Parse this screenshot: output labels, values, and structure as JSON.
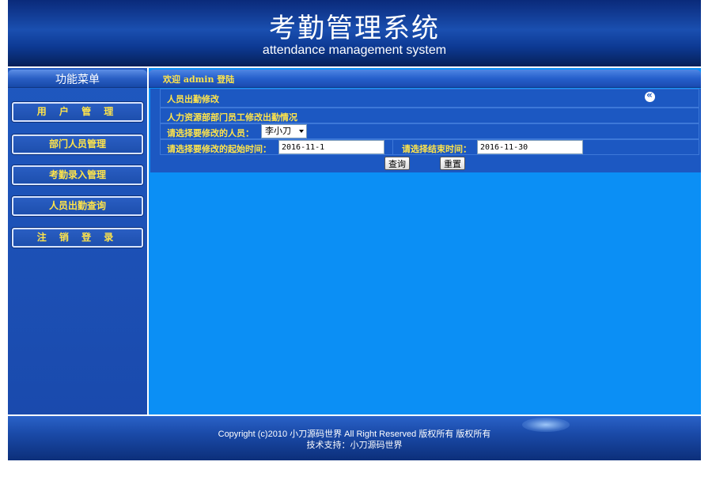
{
  "header": {
    "title": "考勤管理系统",
    "subtitle": "attendance management system"
  },
  "sidebar": {
    "title": "功能菜单",
    "items": [
      {
        "label": "用 户 管 理"
      },
      {
        "label": "部门人员管理"
      },
      {
        "label": "考勤录入管理"
      },
      {
        "label": "人员出勤查询"
      },
      {
        "label": "注 销 登 录"
      }
    ]
  },
  "topbar": {
    "welcome": "欢迎 admin 登陆"
  },
  "form": {
    "section_title": "人员出勤修改",
    "description": "人力资源部部门员工修改出勤情况",
    "person_label": "请选择要修改的人员：",
    "person_value": "李小刀",
    "start_label": "请选择要修改的起始时间：",
    "start_value": "2016-11-1",
    "end_label": "请选择结束时间：",
    "end_value": "2016-11-30",
    "query_button": "查询",
    "reset_button": "重置"
  },
  "footer": {
    "copyright": "Copyright (c)2010  小刀源码世界  All Right Reserved  版权所有  版权所有",
    "support": "技术支持：小刀源码世界"
  },
  "colors": {
    "accent_text": "#ffe44a",
    "main_bg": "#0b8ff5",
    "panel_bg": "#1c58c2"
  }
}
